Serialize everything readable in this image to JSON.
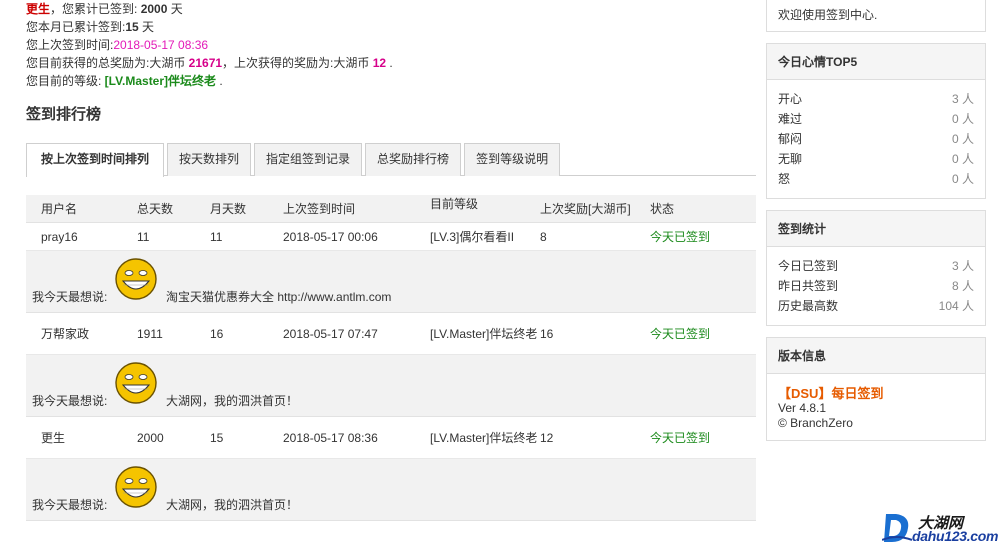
{
  "summary": {
    "line1": {
      "username": "更生",
      "text_a": "，您累计已签到: ",
      "total_days": "2000",
      "unit": " 天"
    },
    "line2": {
      "text_a": "您本月已累计签到:",
      "month_days": "15",
      "unit": " 天"
    },
    "line3": {
      "text_a": "您上次签到时间:",
      "last_time": "2018-05-17 08:36"
    },
    "line4": {
      "text_a": "您目前获得的总奖励为:大湖币 ",
      "total_reward": "21671",
      "text_b": "，上次获得的奖励为:大湖币 ",
      "last_reward": "12",
      "text_c": " ."
    },
    "line5": {
      "text_a": "您目前的等级: ",
      "level": "[LV.Master]伴坛终老",
      "text_b": " ."
    }
  },
  "ranking": {
    "title": "签到排行榜",
    "tabs": [
      "按上次签到时间排列",
      "按天数排列",
      "指定组签到记录",
      "总奖励排行榜",
      "签到等级说明"
    ],
    "headers": [
      "用户名",
      "总天数",
      "月天数",
      "上次签到时间",
      "目前等级",
      "上次奖励[大湖币]",
      "状态"
    ],
    "thought_label": "我今天最想说:",
    "rows": [
      {
        "user": "pray16",
        "total": "11",
        "month": "11",
        "time": "2018-05-17 00:06",
        "level": "[LV.3]偶尔看看II",
        "reward": "8",
        "status": "今天已签到",
        "thought": "淘宝天猫优惠券大全 http://www.antlm.com"
      },
      {
        "user": "万帮家政",
        "total": "1911",
        "month": "16",
        "time": "2018-05-17 07:47",
        "level": "[LV.Master]伴坛终老",
        "reward": "16",
        "status": "今天已签到",
        "thought": "大湖网，我的泗洪首页！"
      },
      {
        "user": "更生",
        "total": "2000",
        "month": "15",
        "time": "2018-05-17 08:36",
        "level": "[LV.Master]伴坛终老",
        "reward": "12",
        "status": "今天已签到",
        "thought": "大湖网，我的泗洪首页！"
      }
    ]
  },
  "sidebar": {
    "welcome": "欢迎使用签到中心.",
    "mood": {
      "title": "今日心情TOP5",
      "items": [
        {
          "label": "开心",
          "value": "3 人"
        },
        {
          "label": "难过",
          "value": "0 人"
        },
        {
          "label": "郁闷",
          "value": "0 人"
        },
        {
          "label": "无聊",
          "value": "0 人"
        },
        {
          "label": "怒",
          "value": "0 人"
        }
      ]
    },
    "stats": {
      "title": "签到统计",
      "items": [
        {
          "label": "今日已签到",
          "value": "3 人"
        },
        {
          "label": "昨日共签到",
          "value": "8 人"
        },
        {
          "label": "历史最高数",
          "value": "104 人"
        }
      ]
    },
    "version": {
      "title": "版本信息",
      "brand": "【DSU】每日签到",
      "ver": "Ver 4.8.1",
      "copyright": "© BranchZero"
    }
  },
  "watermark": {
    "name": "大湖网",
    "url": "dahu123.com"
  },
  "colors": {
    "accent_green": "#1b8a1b",
    "accent_magenta": "#e31ab8",
    "brand_orange": "#e65b00"
  }
}
